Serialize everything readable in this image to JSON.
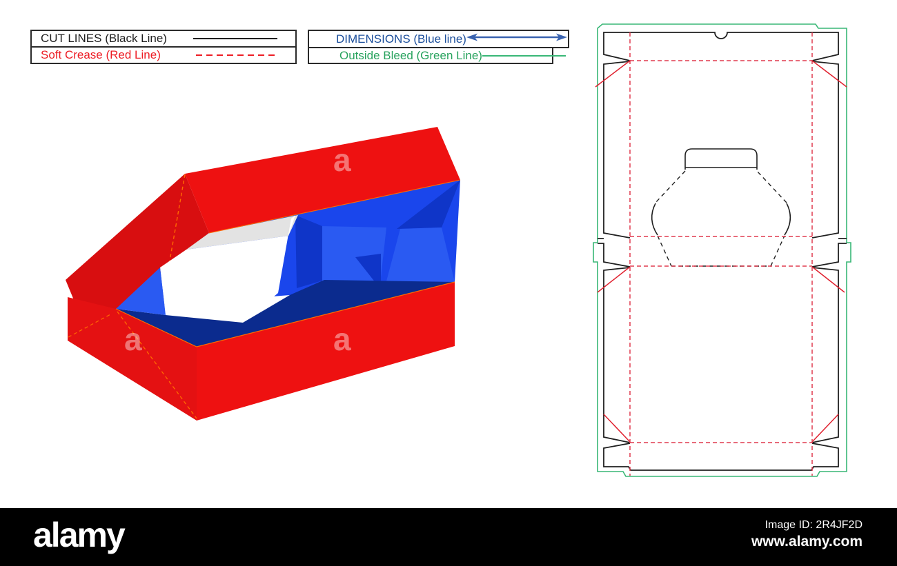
{
  "legend_cut": {
    "cut_label": "CUT LINES (Black Line)",
    "crease_label": "Soft Crease (Red Line)"
  },
  "legend_dim": {
    "dimensions_label": "DIMENSIONS (Blue line)",
    "bleed_label": "Outside Bleed (Green Line)"
  },
  "footer": {
    "brand": "alamy",
    "image_id": "Image ID: 2R4JF2D",
    "website": "www.alamy.com"
  },
  "watermark": {
    "glyph": "a"
  },
  "colors": {
    "cut_black": "#1f1f1f",
    "crease_red_dash": "#e03a4e",
    "crease_red_solid": "#e0202e",
    "dimension_blue": "#3a63b0",
    "bleed_green": "#38b776",
    "text_red": "#ed1c24",
    "text_blue": "#1b4e9b",
    "text_green": "#27a25d",
    "box_red_bright": "#ee1111",
    "box_red_mid": "#e41112",
    "box_red_dark": "#d80e10",
    "box_blue_base": "#1a46ec",
    "box_blue_dark": "#0f35c8",
    "box_blue_light": "#2a5af2",
    "box_blue_navy": "#0b2b8e",
    "inner_gray": "#e3e3e3",
    "edge_orange": "#ff6a00",
    "footer_bg": "#000000"
  }
}
